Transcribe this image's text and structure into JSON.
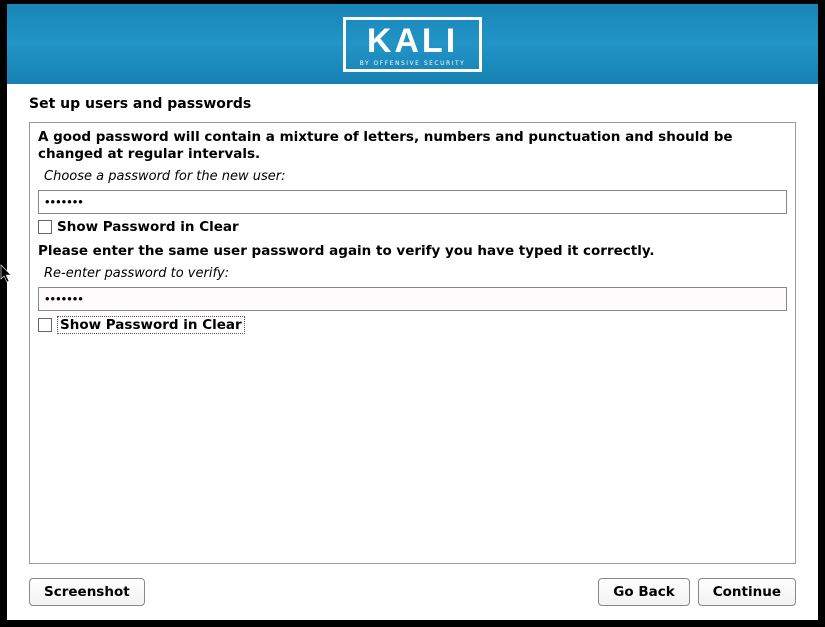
{
  "header": {
    "logo_text": "KALI",
    "logo_subtitle": "BY OFFENSIVE SECURITY"
  },
  "page_title": "Set up users and passwords",
  "form": {
    "password_guidance": "A good password will contain a mixture of letters, numbers and punctuation and should be changed at regular intervals.",
    "password_label": "Choose a password for the new user:",
    "password_value": "•••••••",
    "show_password_1": "Show Password in Clear",
    "verify_guidance": "Please enter the same user password again to verify you have typed it correctly.",
    "verify_label": "Re-enter password to verify:",
    "verify_value": "•••••••",
    "show_password_2": "Show Password in Clear"
  },
  "buttons": {
    "screenshot": "Screenshot",
    "go_back": "Go Back",
    "continue": "Continue"
  }
}
